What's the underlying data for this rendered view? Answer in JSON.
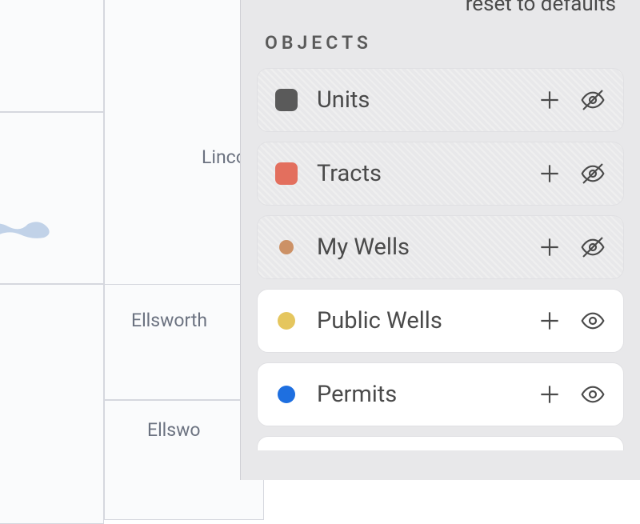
{
  "map": {
    "labels": {
      "lincoln": "Linco",
      "ellsworth1": "Ellsworth",
      "ellsworth2": "Ellswo"
    }
  },
  "sidebar": {
    "reset_label": "reset to defaults",
    "section_header": "OBJECTS",
    "layers": [
      {
        "label": "Units",
        "swatch_shape": "square",
        "swatch_color": "#5a5a5a",
        "visible": false
      },
      {
        "label": "Tracts",
        "swatch_shape": "square",
        "swatch_color": "#e36f5e",
        "visible": false
      },
      {
        "label": "My Wells",
        "swatch_shape": "dot-sm",
        "swatch_color": "#cc9166",
        "visible": false
      },
      {
        "label": "Public Wells",
        "swatch_shape": "dot-lg",
        "swatch_color": "#e5c65e",
        "visible": true
      },
      {
        "label": "Permits",
        "swatch_shape": "dot-lg",
        "swatch_color": "#1e6fe0",
        "visible": true
      }
    ]
  }
}
